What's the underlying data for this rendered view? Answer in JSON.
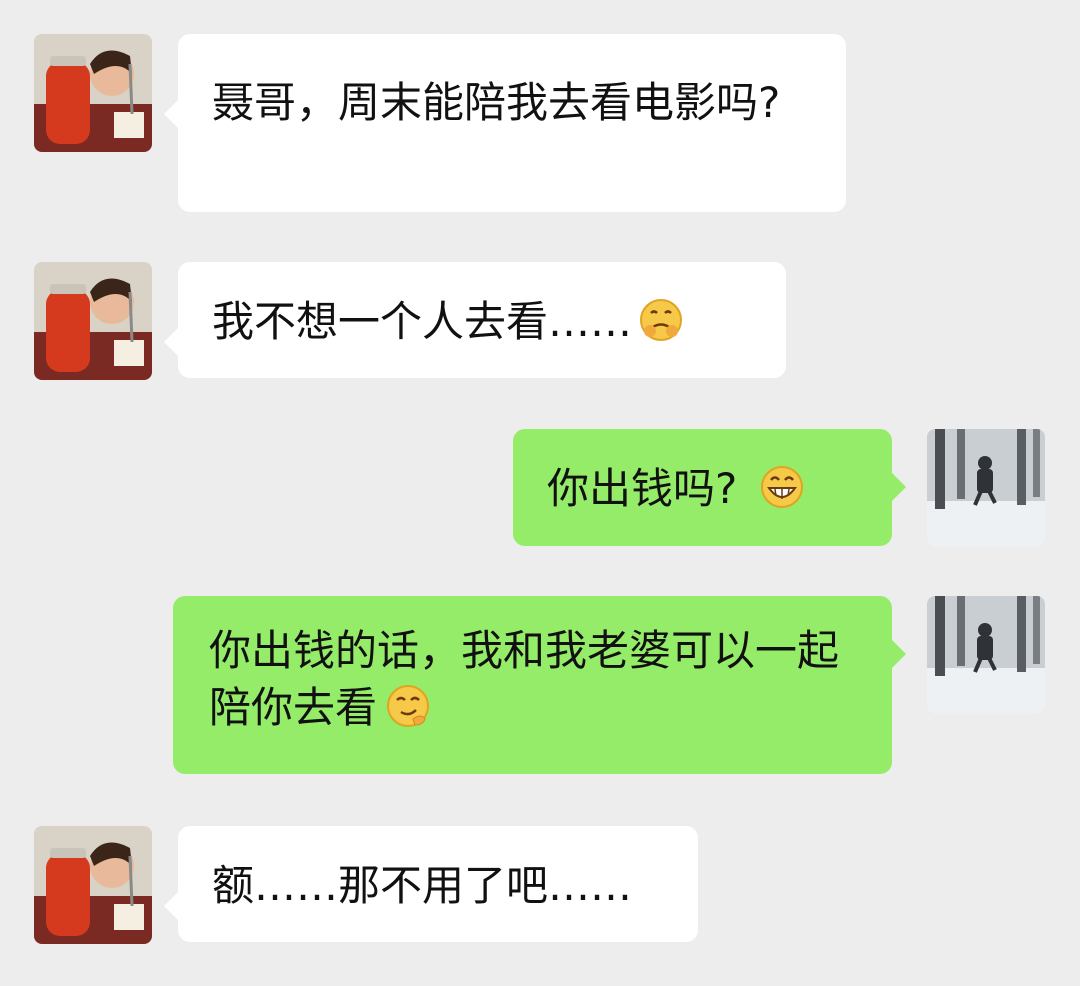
{
  "chat": {
    "messages": [
      {
        "sender": "contact",
        "text": "聂哥，周末能陪我去看电影吗?"
      },
      {
        "sender": "contact",
        "text": "我不想一个人去看……",
        "emoji": "worried-face-emoji"
      },
      {
        "sender": "self",
        "text": "你出钱吗?",
        "emoji": "grinning-face-emoji"
      },
      {
        "sender": "self",
        "text": "你出钱的话，我和我老婆可以一起陪你去看",
        "emoji": "smirk-face-emoji"
      },
      {
        "sender": "contact",
        "text": "额……那不用了吧……"
      }
    ]
  },
  "colors": {
    "background": "#ededed",
    "incoming_bubble": "#ffffff",
    "outgoing_bubble": "#95ec69",
    "text": "#111111"
  },
  "icons": {
    "contact_avatar": "contact-avatar-icon",
    "self_avatar": "self-avatar-icon"
  }
}
